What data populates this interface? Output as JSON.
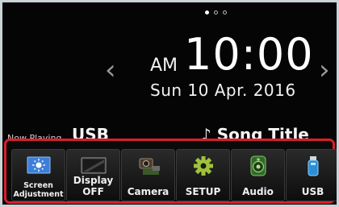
{
  "pager": {
    "pages": 3,
    "active": 1
  },
  "nav": {
    "prev_arrow": "‹",
    "next_arrow": "›"
  },
  "clock": {
    "ampm": "AM",
    "time": "10:00",
    "date": "Sun 10 Apr. 2016"
  },
  "now_playing": {
    "label": "Now Playing",
    "source": "USB",
    "song_prefix": "♪",
    "song_title": "Song Title"
  },
  "shortcuts": [
    {
      "line1": "Screen",
      "line2": "Adjustment",
      "icon": "brightness-icon"
    },
    {
      "label": "Display OFF",
      "icon": "display-off-icon"
    },
    {
      "label": "Camera",
      "icon": "camera-icon"
    },
    {
      "label": "SETUP",
      "icon": "gear-icon"
    },
    {
      "label": "Audio",
      "icon": "speaker-icon"
    },
    {
      "label": "USB",
      "icon": "usb-stick-icon"
    }
  ],
  "colors": {
    "highlight_border": "#d8202b",
    "background": "#050505",
    "text": "#ffffff"
  }
}
